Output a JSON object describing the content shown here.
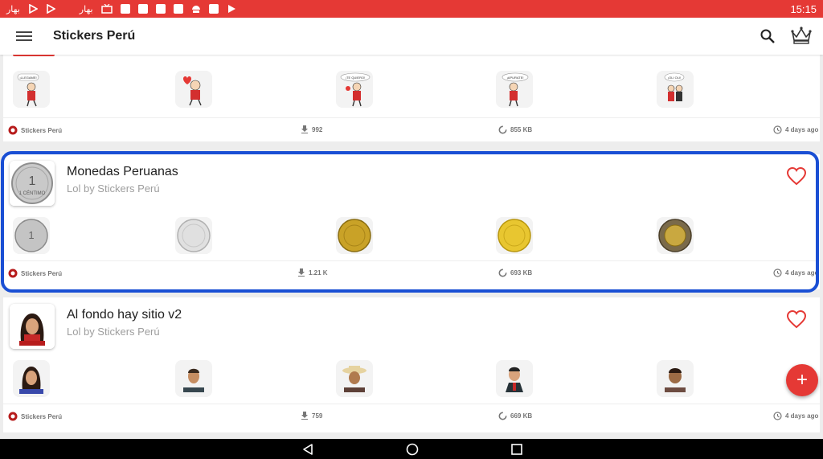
{
  "status_bar": {
    "time": "15:15",
    "left_icons": [
      "app-icon",
      "play-icon",
      "play-icon",
      "moon-icon",
      "app-icon",
      "tv-icon",
      "square-icon",
      "square-icon",
      "square-icon",
      "square-icon",
      "android-icon",
      "square-icon",
      "play-store-icon"
    ],
    "left_label": "بهار"
  },
  "app_bar": {
    "title": "Stickers Perú",
    "icons": [
      "menu-icon",
      "search-icon",
      "crown-icon"
    ]
  },
  "packs": [
    {
      "name": "",
      "subtitle": "",
      "publisher": "Stickers Perú",
      "downloads": "992",
      "size": "855 KB",
      "updated": "4 days ago",
      "sticker_texts": [
        "¡LLEGAME!",
        "",
        "¡TE QUIERO!",
        "¡APURATE!",
        "¡OLI OLI!"
      ]
    },
    {
      "name": "Monedas Peruanas",
      "subtitle": "Lol by Stickers Perú",
      "publisher": "Stickers Perú",
      "downloads": "1.21 K",
      "size": "693 KB",
      "updated": "4 days ago",
      "sticker_texts": [
        "1 CÉNTIMO",
        "",
        "",
        "",
        ""
      ]
    },
    {
      "name": "Al fondo hay sitio v2",
      "subtitle": "Lol by Stickers Perú",
      "publisher": "Stickers Perú",
      "downloads": "759",
      "size": "669 KB",
      "updated": "4 days ago",
      "sticker_texts": [
        "",
        "",
        "",
        "",
        ""
      ]
    }
  ],
  "fab": {
    "label": "+"
  },
  "nav_bar": {
    "icons": [
      "back-icon",
      "home-icon",
      "recents-icon"
    ]
  },
  "colors": {
    "primary": "#e53935",
    "selection": "#1a4fd4",
    "favorite": "#e53935"
  }
}
